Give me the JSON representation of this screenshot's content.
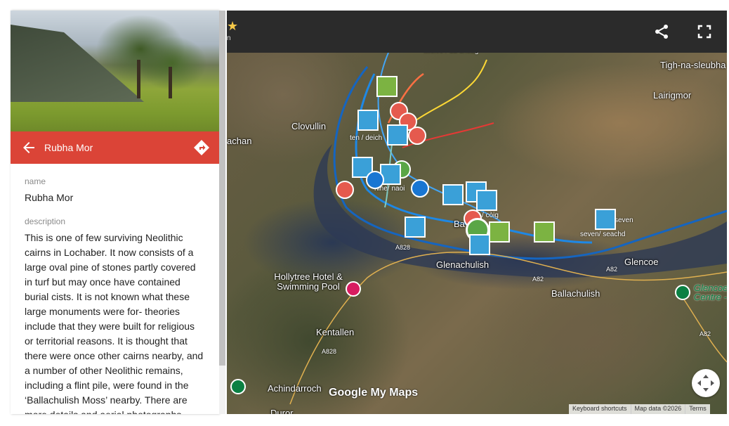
{
  "panel": {
    "title": "Rubha Mor",
    "name_label": "name",
    "name_value": "Rubha Mor",
    "description_label": "description",
    "description_value": "This is one of few surviving Neolithic cairns in Lochaber. It now consists of a large oval pine of stones partly covered in turf but may once have contained burial cists. It is not known what these large monuments were for- theories include that they were built for religious or territorial reasons. It is thought that there were once other cairns nearby, and a number of other Neolithic remains, including a flint pile, were found in the ‘Ballachulish Moss’ nearby. There are more details and aerial photographs"
  },
  "map": {
    "places": {
      "tigh": "Tigh-na-sleubha",
      "lairigmor": "Lairigmor",
      "clovullin": "Clovullin",
      "achan": "achan",
      "ba": "Ba",
      "glenachulish": "Glenachulish",
      "glencoe": "Glencoe",
      "ballachulish": "Ballachulish",
      "hollytree": "Hollytree Hotel & Swimming Pool",
      "kentallen": "Kentallen",
      "achindarroch": "Achindarroch",
      "duror": "Duror",
      "glencoe_centre": "Glencoe Centre -"
    },
    "roads": {
      "a828_1": "A828",
      "a82_1": "A82",
      "a82_2": "A82",
      "a828_2": "A828",
      "a82_3": "A82"
    },
    "marker_labels": {
      "ten": "ten / deich",
      "nine": "nine/ naoi",
      "coig": "/ còig",
      "seven": "seven",
      "seven2": "seven/ seachd",
      "top": "tweive / dà dheug"
    },
    "attribution": {
      "keyboard": "Keyboard shortcuts",
      "data": "Map data ©2026",
      "terms": "Terms"
    },
    "brand": "Google My Maps",
    "top_subtitle": "n"
  }
}
